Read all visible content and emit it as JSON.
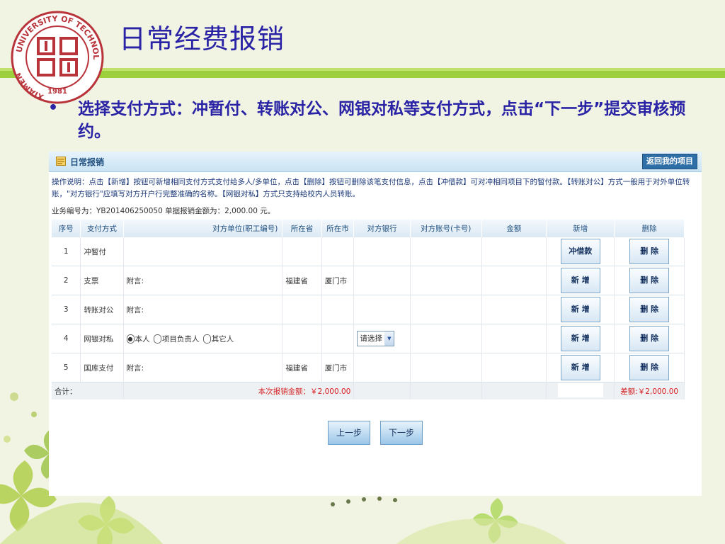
{
  "slide": {
    "title": "日常经费报销",
    "bullet": "•",
    "bullet_text": "选择支付方式：冲暂付、转账对公、网银对私等支付方式，点击“下一步”提交审核预约。",
    "logo": {
      "top_text": "UNIVERSITY OF TECHNOLOGY",
      "side_text": "XIAMEN",
      "year": "1981"
    },
    "colors": {
      "title": "#2a23a6",
      "background": "#f1f4e2",
      "bar_green": "#9ccf3c"
    }
  },
  "panel": {
    "title": "日常报销",
    "return_button": "返回我的项目",
    "instructions": "操作说明：点击【新增】按钮可新增相同支付方式支付给多人/多单位，点击【删除】按钮可删除该笔支付信息，点击【冲借款】可对冲相同项目下的暂付款。【转账对公】方式一般用于对外单位转账，\"对方银行\"应填写对方开户行完整准确的名称。【网银对私】方式只支持给校内人员转账。",
    "business_line": "业务编号为：YB201406250050  单据报销金额为：2,000.00 元。",
    "columns": [
      "序号",
      "支付方式",
      "对方单位(职工编号)",
      "所在省",
      "所在市",
      "对方银行",
      "对方账号(卡号)",
      "金额",
      "新增",
      "删除"
    ],
    "rows": [
      {
        "no": "1",
        "method": "冲暂付",
        "note": "",
        "province": "",
        "city": "",
        "add_label": "冲借款",
        "delete_label": "删 除"
      },
      {
        "no": "2",
        "method": "支票",
        "note": "附言:",
        "province": "福建省",
        "city": "厦门市",
        "add_label": "新 增",
        "delete_label": "删 除"
      },
      {
        "no": "3",
        "method": "转账对公",
        "note": "附言:",
        "province": "",
        "city": "",
        "add_label": "新 增",
        "delete_label": "删 除"
      },
      {
        "no": "4",
        "method": "网银对私",
        "radio_options": [
          "本人",
          "项目负责人",
          "其它人"
        ],
        "radio_selected": "本人",
        "bank_select": "请选择",
        "add_label": "新 增",
        "delete_label": "删 除"
      },
      {
        "no": "5",
        "method": "国库支付",
        "note": "附言:",
        "province": "福建省",
        "city": "厦门市",
        "add_label": "新 增",
        "delete_label": "删 除"
      }
    ],
    "total": {
      "label": "合计：",
      "amount_text": "本次报销金额：￥2,000.00",
      "diff_text": "差额:￥2,000.00"
    },
    "prev_button": "上一步",
    "next_button": "下一步"
  }
}
